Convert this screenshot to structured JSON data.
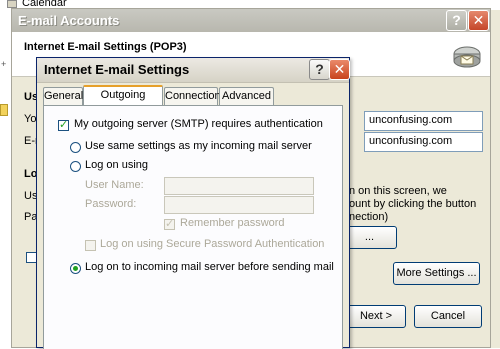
{
  "background_app": {
    "calendar_label": "Calendar"
  },
  "outer_dialog": {
    "title": "E-mail Accounts",
    "header_title": "Internet E-mail Settings (POP3)",
    "fields": [
      {
        "value": "unconfusing.com"
      },
      {
        "value": "unconfusing.com"
      }
    ],
    "text_fragments": {
      "section1": "Use",
      "row1": "You",
      "row2": "E-m",
      "section2": "Log",
      "row3": "Use",
      "row4": "Pas",
      "right_line1": "n on this screen, we",
      "right_line2": "ount by clicking the button",
      "right_line3": "nection)"
    },
    "test_button_label": "...",
    "more_settings_label": "More Settings ...",
    "next_label": "Next >",
    "cancel_label": "Cancel"
  },
  "inner_dialog": {
    "title": "Internet E-mail Settings",
    "tabs": [
      "General",
      "Outgoing Server",
      "Connection",
      "Advanced"
    ],
    "active_tab": "Outgoing Server",
    "smtp_auth_label": "My outgoing server (SMTP) requires authentication",
    "smtp_auth_checked": true,
    "option_same_settings": "Use same settings as my incoming mail server",
    "option_log_on_using": "Log on using",
    "user_name_label": "User Name:",
    "password_label": "Password:",
    "remember_password_label": "Remember password",
    "spa_label": "Log on using Secure Password Authentication",
    "option_log_on_incoming": "Log on to incoming mail server before sending mail",
    "selected_option": "Log on to incoming mail server before sending mail"
  },
  "colors": {
    "dialog_bg": "#ece9d8",
    "active_tab_accent": "#e6a02a",
    "close_button": "#c8421d",
    "check_green": "#21a121"
  }
}
